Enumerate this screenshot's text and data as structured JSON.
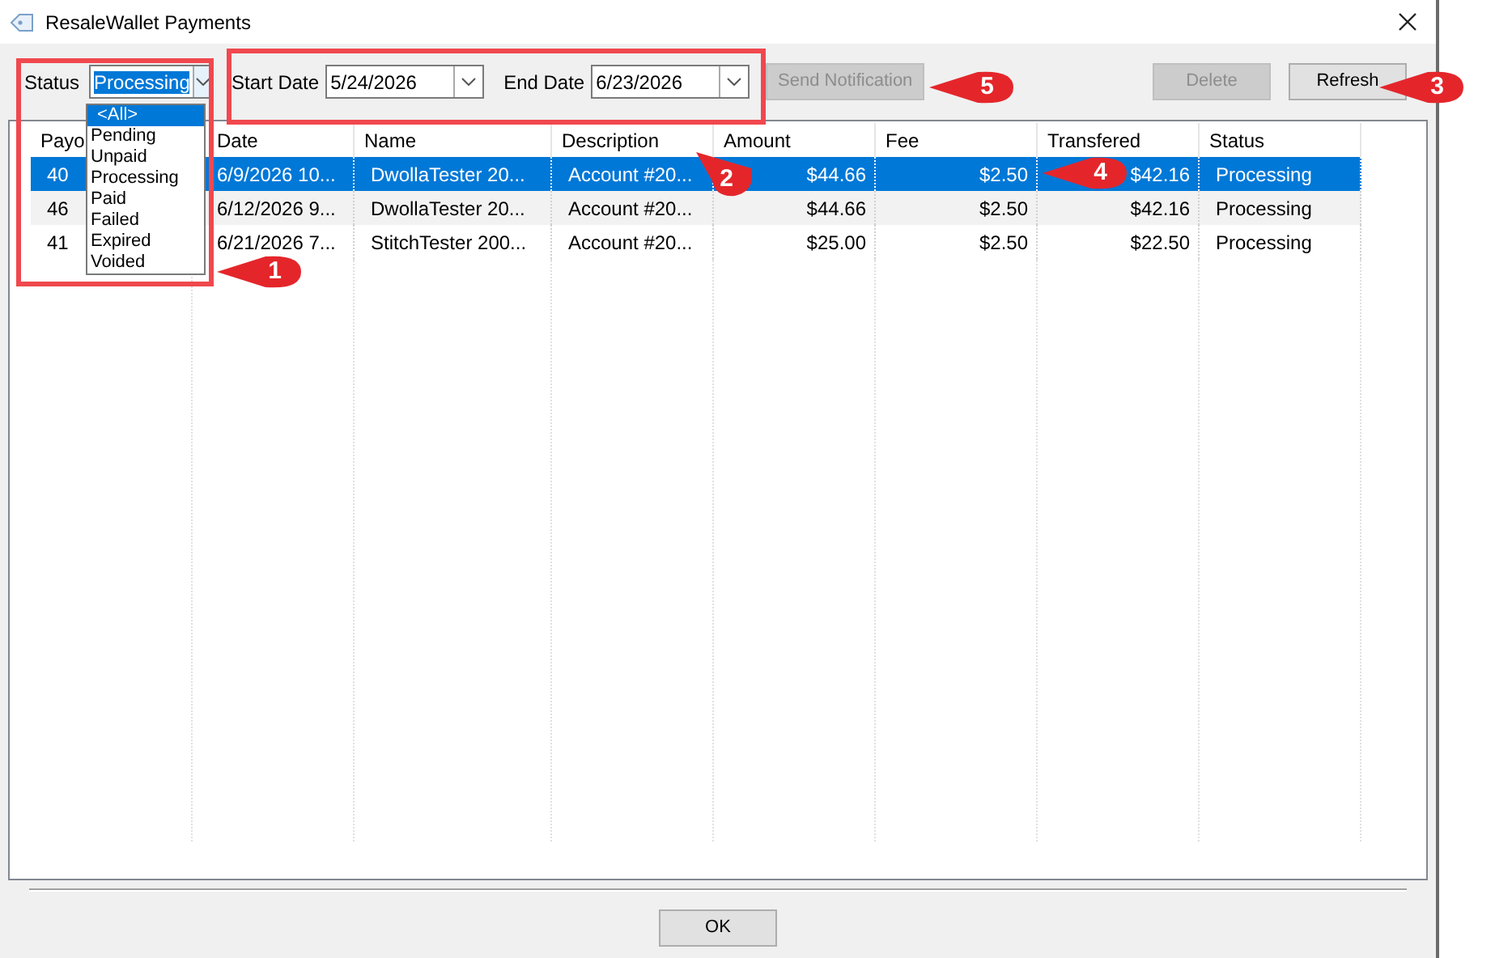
{
  "window": {
    "title": "ResaleWallet Payments"
  },
  "filters": {
    "status_label": "Status",
    "status_value": "Processing",
    "start_label": "Start Date",
    "start_value": "5/24/2026",
    "end_label": "End Date",
    "end_value": "6/23/2026"
  },
  "status_dropdown": {
    "options": [
      {
        "label": "<All>",
        "selected": true
      },
      {
        "label": "Pending",
        "selected": false
      },
      {
        "label": "Unpaid",
        "selected": false
      },
      {
        "label": "Processing",
        "selected": false
      },
      {
        "label": "Paid",
        "selected": false
      },
      {
        "label": "Failed",
        "selected": false
      },
      {
        "label": "Expired",
        "selected": false
      },
      {
        "label": "Voided",
        "selected": false
      }
    ]
  },
  "toolbar_buttons": [
    {
      "label": "Send Notification",
      "disabled": true
    },
    {
      "label": "Delete",
      "disabled": true
    },
    {
      "label": "Refresh",
      "disabled": false
    }
  ],
  "table": {
    "columns": [
      {
        "label": "Payo"
      },
      {
        "label": "Date"
      },
      {
        "label": "Name"
      },
      {
        "label": "Description"
      },
      {
        "label": "Amount"
      },
      {
        "label": "Fee"
      },
      {
        "label": "Transfered"
      },
      {
        "label": "Status"
      }
    ],
    "rows": [
      {
        "selected": true,
        "cells": [
          "40",
          "6/9/2026 10...",
          "DwollaTester 20...",
          "Account #20...",
          "$44.66",
          "$2.50",
          "$42.16",
          "Processing"
        ]
      },
      {
        "selected": false,
        "cells": [
          "46",
          "6/12/2026 9...",
          "DwollaTester 20...",
          "Account #20...",
          "$44.66",
          "$2.50",
          "$42.16",
          "Processing"
        ]
      },
      {
        "selected": false,
        "cells": [
          "41",
          "6/21/2026 7...",
          "StitchTester 200...",
          "Account #20...",
          "$25.00",
          "$2.50",
          "$22.50",
          "Processing"
        ]
      }
    ]
  },
  "footer_button": "OK",
  "annotations": [
    {
      "label": "1"
    },
    {
      "label": "2"
    },
    {
      "label": "3"
    },
    {
      "label": "4"
    },
    {
      "label": "5"
    }
  ]
}
